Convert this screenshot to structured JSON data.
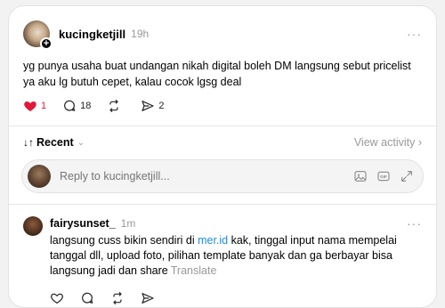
{
  "post": {
    "username": "kucingketjill",
    "time": "19h",
    "more": "···",
    "text": "yg punya usaha buat undangan nikah digital boleh DM langsung sebut pricelist ya aku lg butuh cepet, kalau cocok lgsg deal",
    "likes": "1",
    "comments": "18",
    "shares": "2"
  },
  "sort": {
    "label": "Recent",
    "view_activity": "View activity ›"
  },
  "reply": {
    "placeholder": "Reply to kucingketjill..."
  },
  "comment": {
    "username": "fairysunset_",
    "time": "1m",
    "more": "···",
    "text_before": "langsung cuss bikin sendiri di ",
    "link": "mer.id",
    "text_after": " kak, tinggal input nama mempelai tanggal dll, upload foto, pilihan template banyak dan ga berbayar bisa langsung jadi dan share",
    "translate": "Translate"
  },
  "colors": {
    "like": "#e1193b",
    "link": "#1d8cd8",
    "muted": "#999999"
  }
}
